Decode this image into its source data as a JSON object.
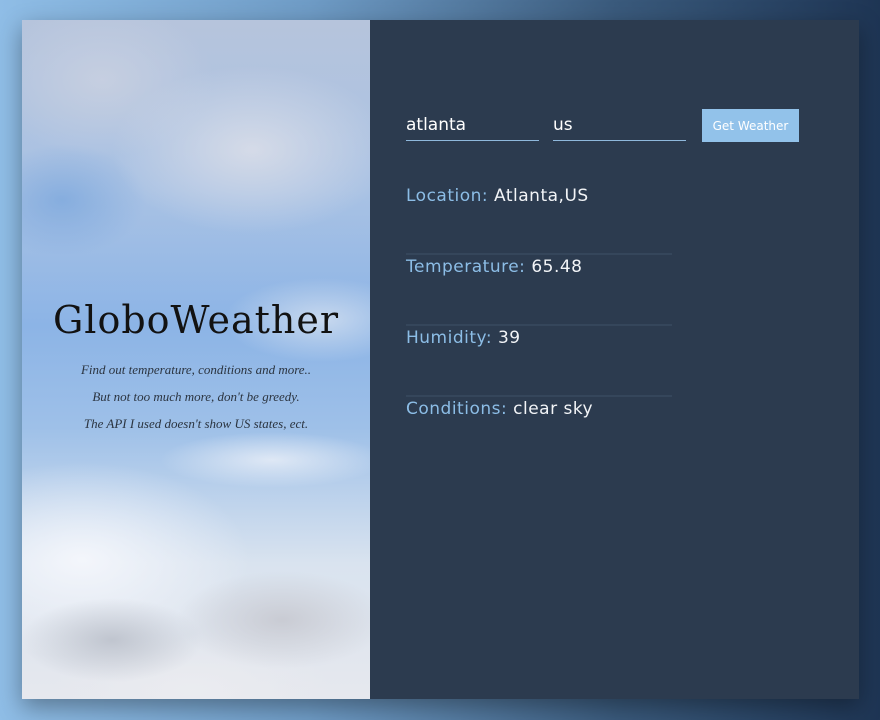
{
  "brand": {
    "title": "GloboWeather",
    "taglines": [
      "Find out temperature, conditions and more..",
      "But not too much more, don't be greedy.",
      "The API I used doesn't show US states, ect."
    ]
  },
  "search": {
    "city_value": "atlanta",
    "country_value": "us",
    "button_label": "Get Weather"
  },
  "results": [
    {
      "label": "Location:",
      "value": "Atlanta,US"
    },
    {
      "label": "Temperature:",
      "value": "65.48"
    },
    {
      "label": "Humidity:",
      "value": "39"
    },
    {
      "label": "Conditions:",
      "value": "clear sky"
    }
  ],
  "colors": {
    "panel_background": "#2c3b4f",
    "label_accent": "#8cbde6",
    "button_background": "#92c2ea"
  }
}
